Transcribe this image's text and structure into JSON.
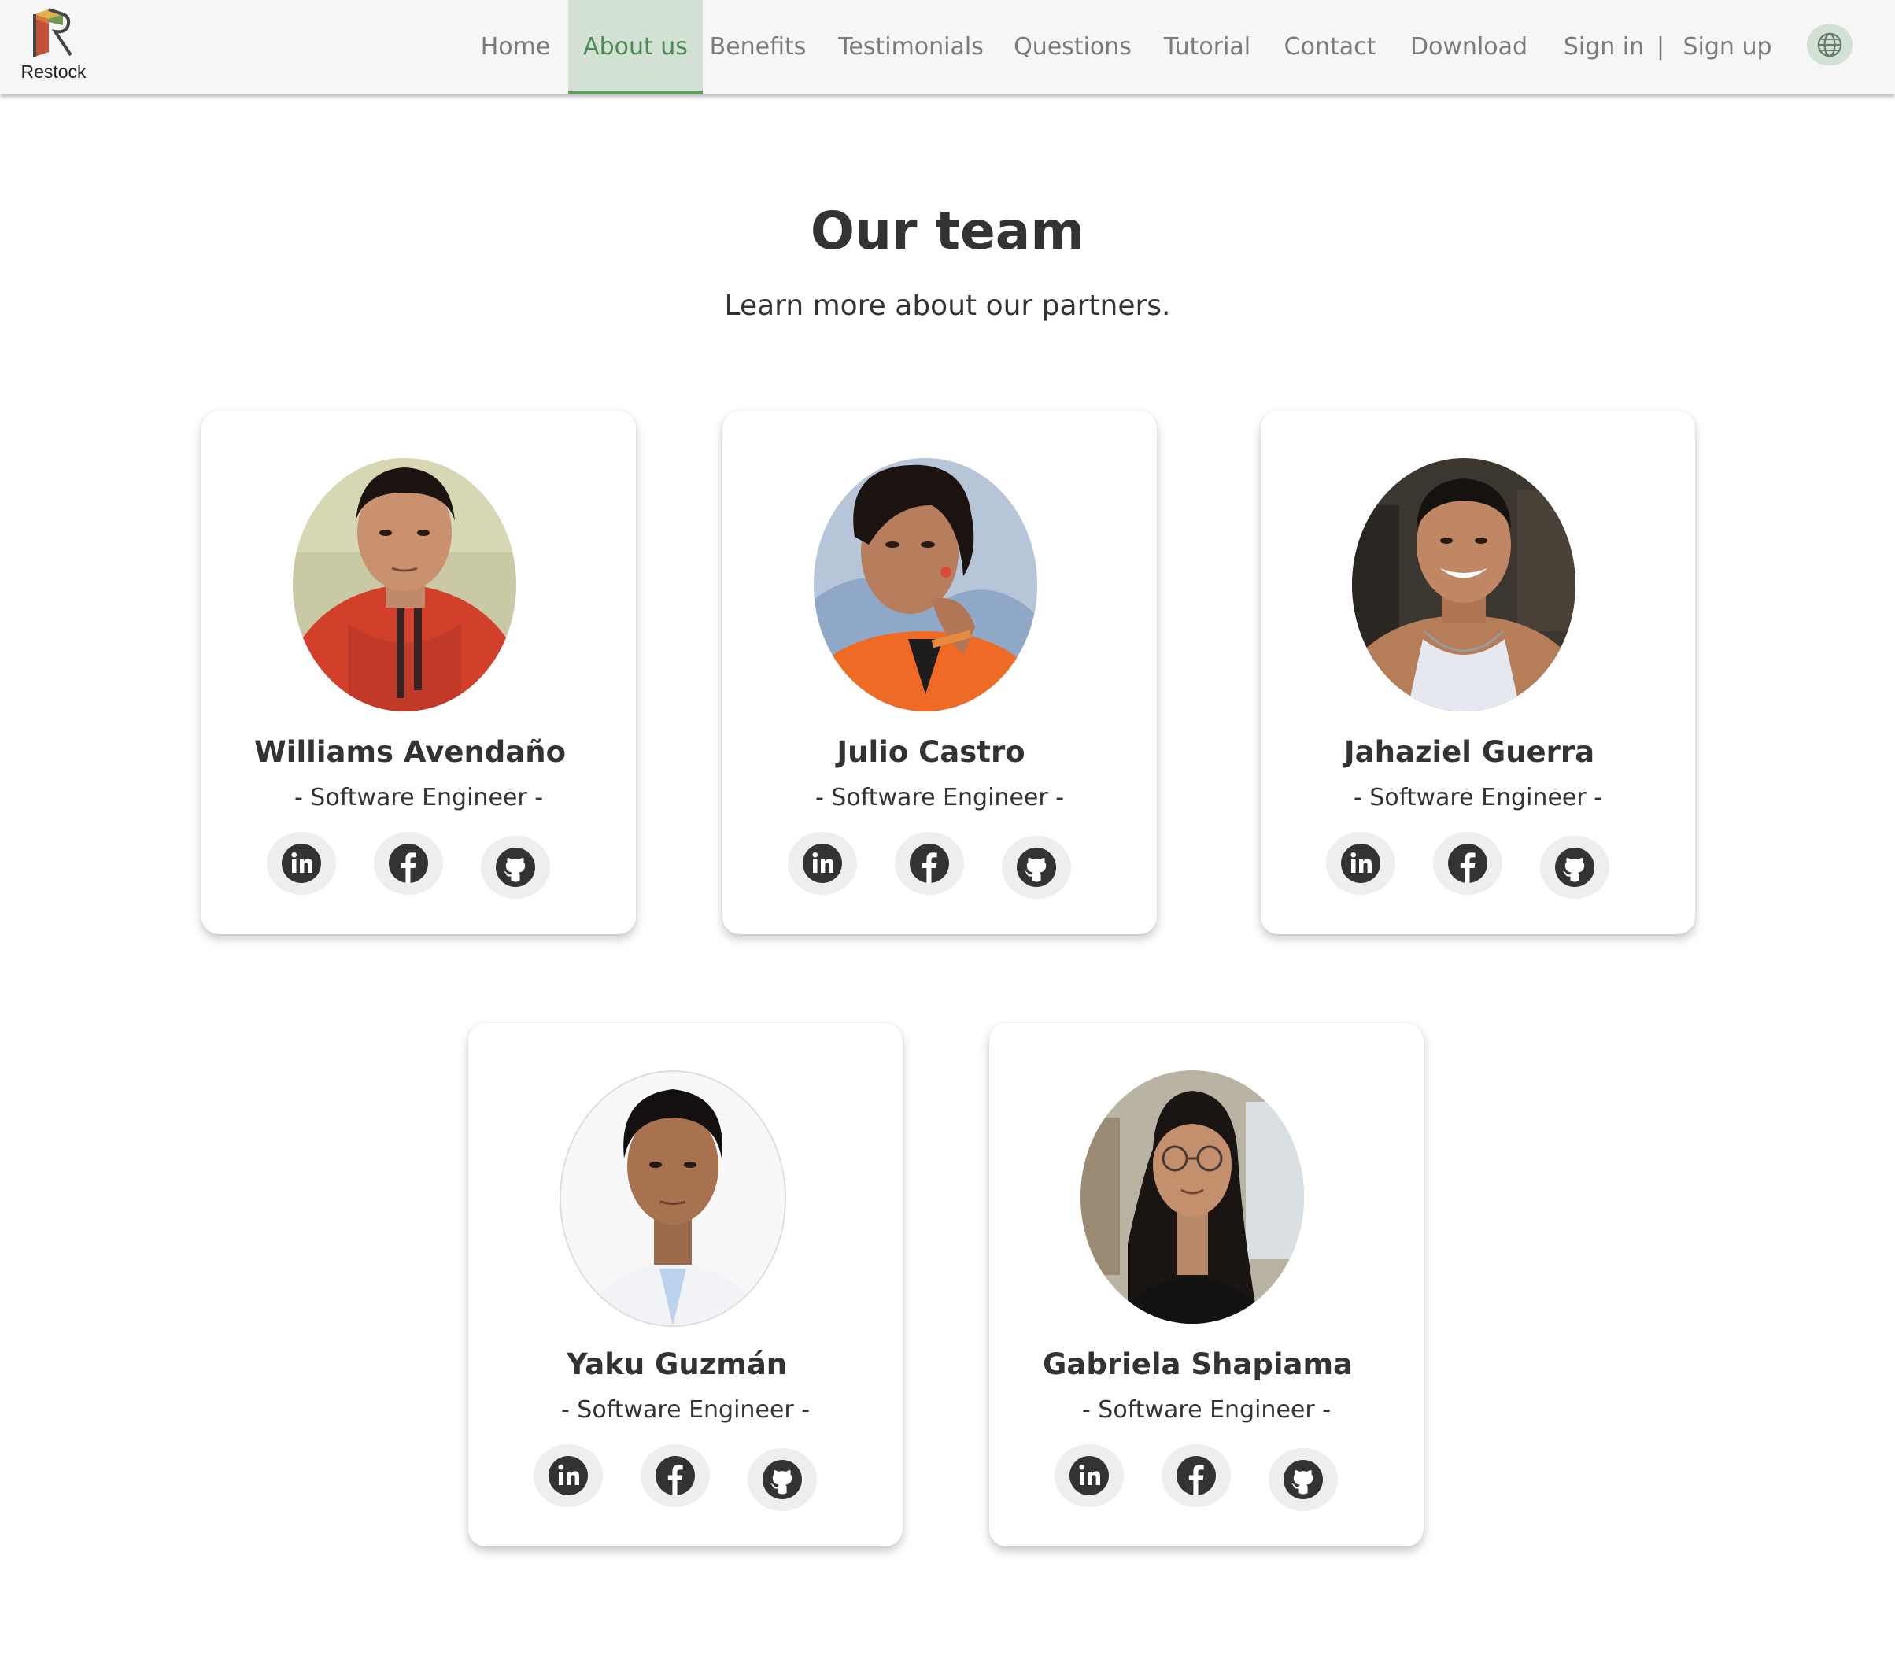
{
  "header": {
    "logo_text": "Restock",
    "nav": [
      {
        "label": "Home",
        "active": false
      },
      {
        "label": "About us",
        "active": true
      },
      {
        "label": "Benefits",
        "active": false
      },
      {
        "label": "Testimonials",
        "active": false
      },
      {
        "label": "Questions",
        "active": false
      },
      {
        "label": "Tutorial",
        "active": false
      },
      {
        "label": "Contact",
        "active": false
      },
      {
        "label": "Download",
        "active": false
      }
    ],
    "sign_in": "Sign in",
    "separator": "|",
    "sign_up": "Sign up",
    "language_icon": "globe-icon"
  },
  "colors": {
    "accent": "#5f9a63",
    "accent_bg": "#d3e0d4",
    "nav_text": "#7b7b7b",
    "text": "#333333",
    "social_bg": "#eeeeee"
  },
  "section": {
    "title": "Our team",
    "subtitle": "Learn more about our partners."
  },
  "team": [
    {
      "name": "Williams Avendaño",
      "role": "- Software Engineer -",
      "photo": "portrait-red-hoodie"
    },
    {
      "name": "Julio Castro",
      "role": "- Software Engineer -",
      "photo": "portrait-orange-shirt-sky"
    },
    {
      "name": "Jahaziel Guerra",
      "role": "- Software Engineer -",
      "photo": "portrait-white-tank-top"
    },
    {
      "name": "Yaku Guzmán",
      "role": "- Software Engineer -",
      "photo": "portrait-white-shirt"
    },
    {
      "name": "Gabriela Shapiama",
      "role": "- Software Engineer -",
      "photo": "portrait-glasses-black-top"
    }
  ],
  "social_icons": [
    "linkedin-icon",
    "facebook-icon",
    "github-icon"
  ]
}
